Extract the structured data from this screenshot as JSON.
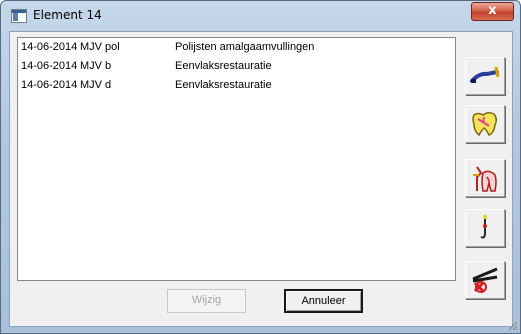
{
  "window": {
    "title": "Element 14",
    "close_label": "x"
  },
  "list": {
    "rows": [
      {
        "date": "14-06-2014",
        "code": "MJV pol",
        "description": "Polijsten amalgaamvullingen"
      },
      {
        "date": "14-06-2014",
        "code": "MJV b",
        "description": "Eenvlaksrestauratie"
      },
      {
        "date": "14-06-2014",
        "code": "MJV d",
        "description": "Eenvlaksrestauratie"
      }
    ]
  },
  "toolbar": {
    "icons": [
      "probe-tool-icon",
      "tooth-surface-icon",
      "root-tooth-icon",
      "hook-instrument-icon",
      "extraction-forceps-icon"
    ]
  },
  "buttons": {
    "wijzig_label": "Wijzig",
    "annuleer_label": "Annuleer"
  },
  "colors": {
    "titlebar": "#b2c8e0",
    "close": "#c2402a",
    "dialog_bg": "#f0f0f0",
    "disabled_text": "#a6a6a6"
  }
}
